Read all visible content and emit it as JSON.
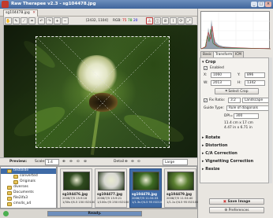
{
  "window": {
    "title": "Raw Therapee v2.3 - sg104478.jpg"
  },
  "tab": {
    "label": "sg104478.jpg"
  },
  "toolbar": {
    "coord": "[2432, 1104]",
    "rgb_label": "RGB:",
    "r": "75",
    "g": "78",
    "b": "20"
  },
  "preview_bar": {
    "preview_label": "Preview:",
    "scale_label": "Scale:",
    "scale_value": "1:4",
    "detail_label": "Detail",
    "size_value": "Large"
  },
  "file_tree": {
    "items": [
      {
        "label": "testslide",
        "indent": 1,
        "selected": true
      },
      {
        "label": "converted",
        "indent": 2,
        "selected": false
      },
      {
        "label": "Originals",
        "indent": 2,
        "selected": false
      },
      {
        "label": "diverses",
        "indent": 1,
        "selected": false
      },
      {
        "label": "Documents",
        "indent": 1,
        "selected": false
      },
      {
        "label": "file2ifa3",
        "indent": 1,
        "selected": false
      },
      {
        "label": "cms4s_a4",
        "indent": 1,
        "selected": false
      }
    ]
  },
  "thumbnails": [
    {
      "name": "sg104476.jpg",
      "date": "2008/7/5 15:9:16",
      "exif": "1/30s f/4.5 150 ISO100",
      "color": "#2f4a1f",
      "active": false
    },
    {
      "name": "sg104477.jpg",
      "date": "2008/7/5 15:9:21",
      "exif": "1/100s f/5 250 ISO100",
      "color": "#d8d8d2",
      "active": false
    },
    {
      "name": "sg104478.jpg",
      "date": "2008/7/5 11:54:33",
      "exif": "1/1.3s f/4.5 95 ISO100",
      "color": "#3d6a22",
      "active": true
    },
    {
      "name": "sg104479.jpg",
      "date": "2008/7/5 11:54:40",
      "exif": "1/1.1s f/4.5 95 ISO100",
      "color": "#5a7f30",
      "active": false
    }
  ],
  "status": {
    "text": "Ready.",
    "progress": 1.0
  },
  "right_panel": {
    "tabs": [
      "Basic",
      "Transform",
      "ICM"
    ],
    "active_tab": "Transform",
    "crop": {
      "section_label": "Crop",
      "enabled_label": "Enabled",
      "x_label": "X:",
      "x_value": "1060",
      "y_label": "Y:",
      "y_value": "896",
      "w_label": "W:",
      "w_value": "2013",
      "h_label": "H:",
      "h_value": "1342",
      "select_crop_label": "Select Crop",
      "fix_ratio_label": "Fix Ratio:",
      "ratio_value": "3:2",
      "orientation_value": "Landscape",
      "guide_type_label": "Guide Type:",
      "guide_value": "Rule of diagonals",
      "dpi_label": "DPI=",
      "dpi_value": "300",
      "size_cm": "11.4 cm x 17 cm",
      "size_in": "4.47 in x 6.71 in"
    },
    "sections": [
      "Rotate",
      "Distortion",
      "C/A Correction",
      "Vignetting Correction",
      "Resize"
    ],
    "save_label": "Save Image",
    "preferences_label": "Preferences"
  }
}
